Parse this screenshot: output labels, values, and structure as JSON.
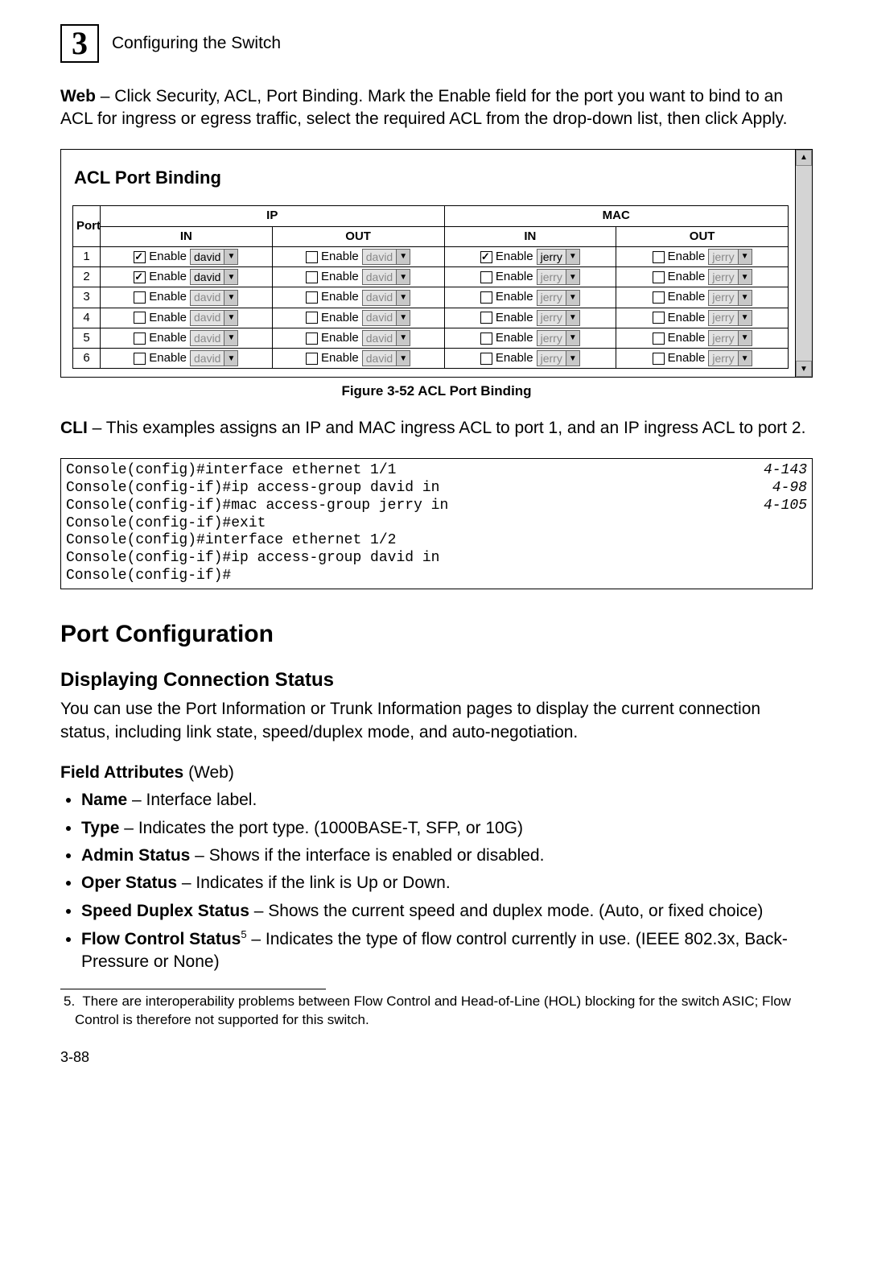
{
  "header": {
    "chapter_icon": "3",
    "title": "Configuring the Switch"
  },
  "intro": {
    "lead": "Web",
    "text": " – Click Security, ACL, Port Binding. Mark the Enable field for the port you want to bind to an ACL for ingress or egress traffic, select the required ACL from the drop-down list, then click Apply."
  },
  "figure": {
    "title": "ACL Port Binding",
    "columns": {
      "port": "Port",
      "ip": "IP",
      "mac": "MAC",
      "in": "IN",
      "out": "OUT"
    },
    "enable_label": "Enable",
    "rows": [
      {
        "port": "1",
        "ip_in": {
          "checked": true,
          "value": "david",
          "active": true
        },
        "ip_out": {
          "checked": false,
          "value": "david",
          "active": false
        },
        "mac_in": {
          "checked": true,
          "value": "jerry",
          "active": true
        },
        "mac_out": {
          "checked": false,
          "value": "jerry",
          "active": false
        }
      },
      {
        "port": "2",
        "ip_in": {
          "checked": true,
          "value": "david",
          "active": true
        },
        "ip_out": {
          "checked": false,
          "value": "david",
          "active": false
        },
        "mac_in": {
          "checked": false,
          "value": "jerry",
          "active": false
        },
        "mac_out": {
          "checked": false,
          "value": "jerry",
          "active": false
        }
      },
      {
        "port": "3",
        "ip_in": {
          "checked": false,
          "value": "david",
          "active": false
        },
        "ip_out": {
          "checked": false,
          "value": "david",
          "active": false
        },
        "mac_in": {
          "checked": false,
          "value": "jerry",
          "active": false
        },
        "mac_out": {
          "checked": false,
          "value": "jerry",
          "active": false
        }
      },
      {
        "port": "4",
        "ip_in": {
          "checked": false,
          "value": "david",
          "active": false
        },
        "ip_out": {
          "checked": false,
          "value": "david",
          "active": false
        },
        "mac_in": {
          "checked": false,
          "value": "jerry",
          "active": false
        },
        "mac_out": {
          "checked": false,
          "value": "jerry",
          "active": false
        }
      },
      {
        "port": "5",
        "ip_in": {
          "checked": false,
          "value": "david",
          "active": false
        },
        "ip_out": {
          "checked": false,
          "value": "david",
          "active": false
        },
        "mac_in": {
          "checked": false,
          "value": "jerry",
          "active": false
        },
        "mac_out": {
          "checked": false,
          "value": "jerry",
          "active": false
        }
      },
      {
        "port": "6",
        "ip_in": {
          "checked": false,
          "value": "david",
          "active": false
        },
        "ip_out": {
          "checked": false,
          "value": "david",
          "active": false
        },
        "mac_in": {
          "checked": false,
          "value": "jerry",
          "active": false
        },
        "mac_out": {
          "checked": false,
          "value": "jerry",
          "active": false
        }
      }
    ],
    "caption": "Figure 3-52   ACL Port Binding"
  },
  "cli_intro": {
    "lead": "CLI",
    "text": " – This examples assigns an IP and MAC ingress ACL to port 1, and an IP ingress ACL to port 2."
  },
  "cli": [
    {
      "cmd": "Console(config)#interface ethernet 1/1",
      "ref": "4-143"
    },
    {
      "cmd": "Console(config-if)#ip access-group david in",
      "ref": "4-98"
    },
    {
      "cmd": "Console(config-if)#mac access-group jerry in",
      "ref": "4-105"
    },
    {
      "cmd": "Console(config-if)#exit",
      "ref": ""
    },
    {
      "cmd": "Console(config)#interface ethernet 1/2",
      "ref": ""
    },
    {
      "cmd": "Console(config-if)#ip access-group david in",
      "ref": ""
    },
    {
      "cmd": "Console(config-if)#",
      "ref": ""
    }
  ],
  "section": {
    "h1": "Port Configuration",
    "h2": "Displaying Connection Status",
    "h2_text": "You can use the Port Information or Trunk Information pages to display the current connection status, including link state, speed/duplex mode, and auto-negotiation.",
    "h3": "Field Attributes",
    "h3_paren": " (Web)"
  },
  "attrs": [
    {
      "label": "Name",
      "text": " – Interface label."
    },
    {
      "label": "Type",
      "text": " – Indicates the port type. (1000BASE-T, SFP, or 10G)"
    },
    {
      "label": "Admin Status",
      "text": " – Shows if the interface is enabled or disabled."
    },
    {
      "label": "Oper Status",
      "text": " – Indicates if the link is Up or Down."
    },
    {
      "label": "Speed Duplex Status",
      "text": " – Shows the current speed and duplex mode. (Auto, or fixed choice)"
    },
    {
      "label": "Flow Control Status",
      "sup": "5",
      "text": " – Indicates the type of flow control currently in use. (IEEE 802.3x, Back-Pressure or None)"
    }
  ],
  "footnote": {
    "num": "5.",
    "text": "There are interoperability problems between Flow Control and Head-of-Line (HOL) blocking for the switch ASIC; Flow Control is therefore not supported for this switch."
  },
  "page_number": "3-88"
}
